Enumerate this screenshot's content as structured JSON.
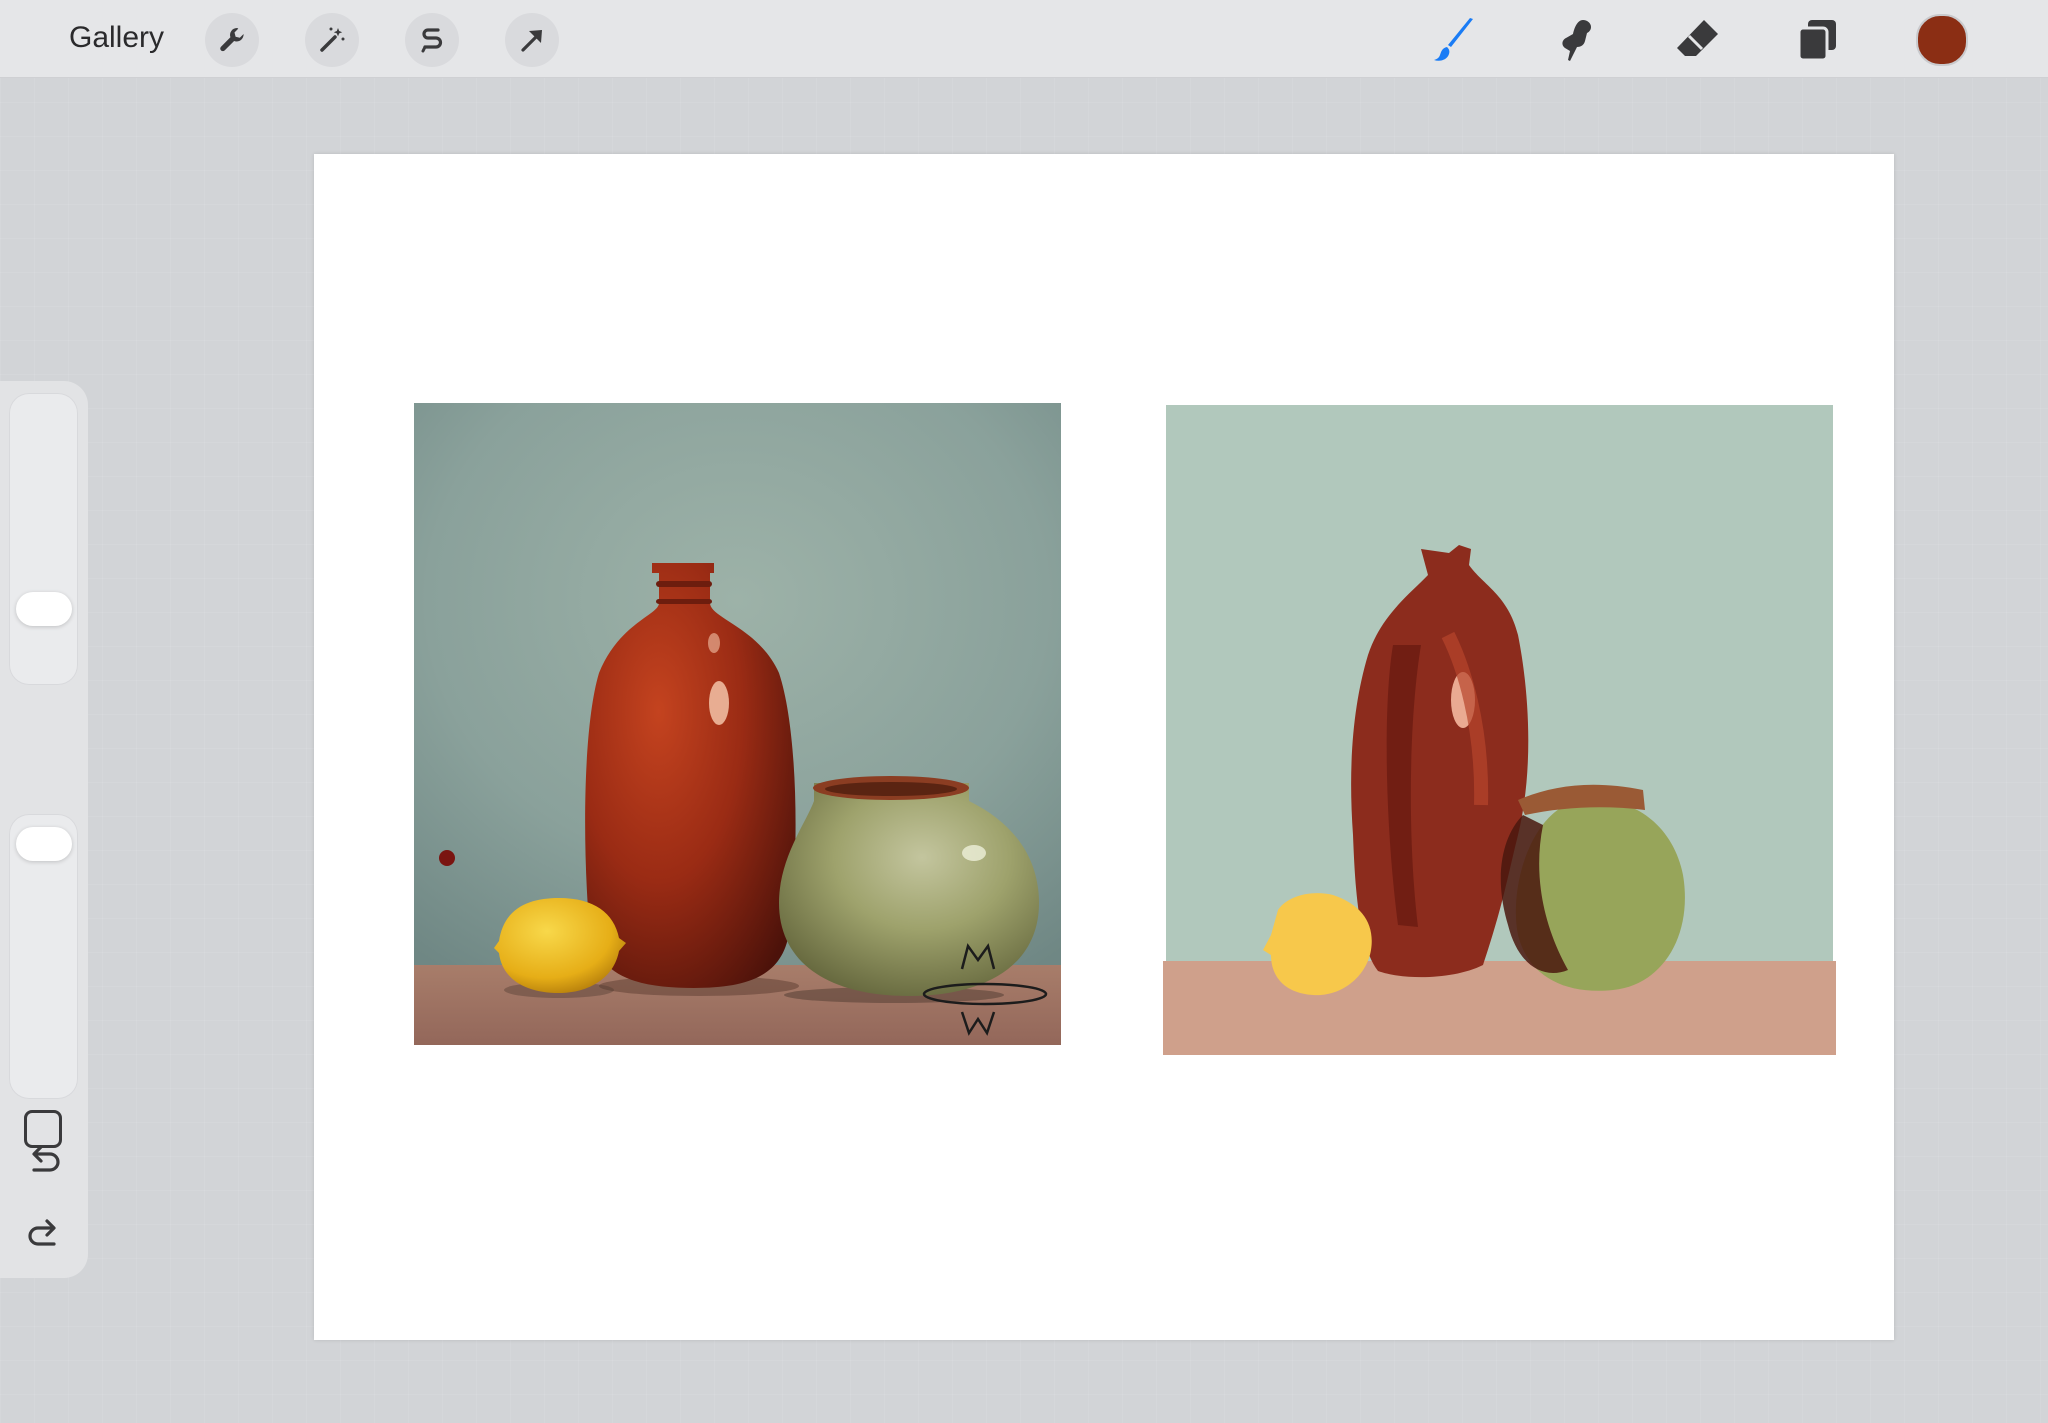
{
  "topbar": {
    "gallery_label": "Gallery",
    "left_tools": [
      {
        "name": "actions-wrench-icon"
      },
      {
        "name": "adjustments-magic-wand-icon"
      },
      {
        "name": "selection-s-icon"
      },
      {
        "name": "transform-arrow-icon"
      }
    ],
    "right_tools": [
      {
        "name": "brush-icon",
        "active": true,
        "active_color": "#1a7cf5"
      },
      {
        "name": "smudge-icon",
        "active": false
      },
      {
        "name": "eraser-icon",
        "active": false
      },
      {
        "name": "layers-icon",
        "active": false
      }
    ],
    "current_color": "#8b2e14"
  },
  "sidebar": {
    "brush_size_level": 0.23,
    "opacity_level": 0.95
  },
  "canvas": {
    "background": "#ffffff",
    "reference": {
      "signature": "M W",
      "colors": {
        "wall": "#8fa6a0",
        "table": "#a57b68",
        "vase": "#9b2b15",
        "pot": "#9aa06a",
        "lemon": "#e9b71f"
      }
    },
    "painting": {
      "colors": {
        "wall": "#b1c8bc",
        "table": "#cfa08b",
        "vase": "#8c2c1d",
        "pot": "#97a55a",
        "pot_rim": "#9a5a35",
        "lemon": "#f7c84b"
      }
    }
  }
}
